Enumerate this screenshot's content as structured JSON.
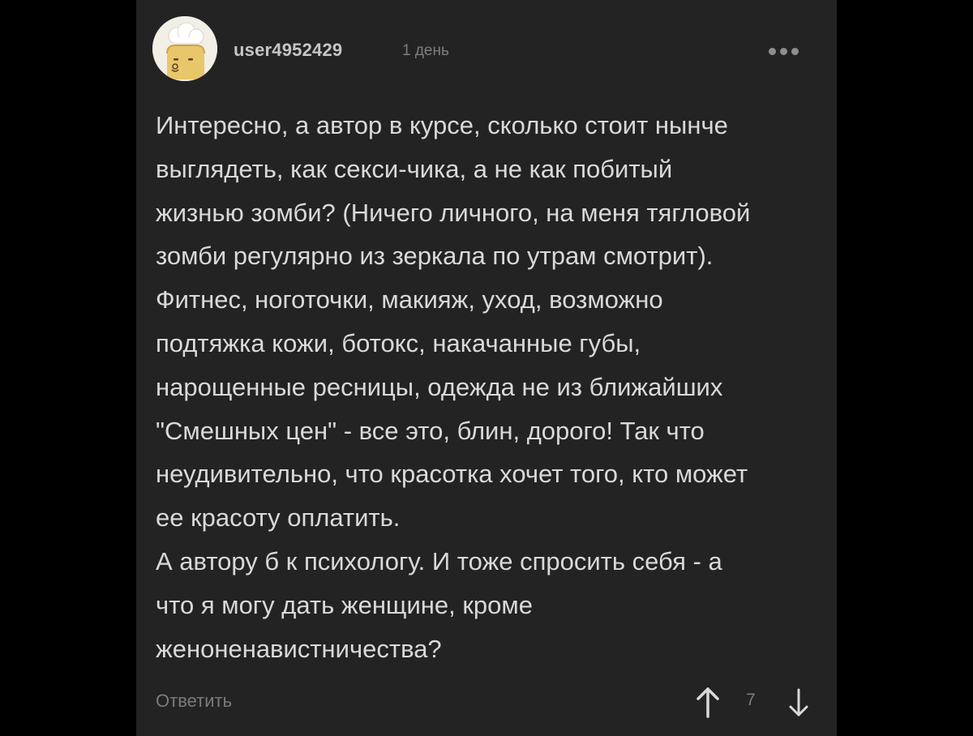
{
  "comment": {
    "author": {
      "username": "user4952429",
      "avatar_icon": "chef-hat-toast-avatar-icon"
    },
    "posted_ago": "1 день",
    "more_icon": "more-dots-icon",
    "text_lines": [
      "Интересно, а автор в курсе, сколько стоит нынче",
      "выглядеть, как секси-чика, а не как побитый",
      "жизнью зомби? (Ничего личного, на меня тягловой",
      "зомби регулярно из зеркала по утрам смотрит).",
      "Фитнес, ноготочки, макияж, уход, возможно",
      "подтяжка кожи, ботокс, накачанные губы,",
      "нарощенные ресницы, одежда не из ближайших",
      "\"Смешных цен\" - все это, блин, дорого! Так что",
      "неудивительно, что красотка хочет того, кто может",
      "ее красоту оплатить.",
      "А автору б к психологу. И тоже спросить себя - а",
      "что я могу дать женщине, кроме",
      "женоненавистничества?"
    ],
    "actions": {
      "reply_label": "Ответить",
      "upvote_icon": "arrow-up-icon",
      "downvote_icon": "arrow-down-icon",
      "rating": "7"
    }
  },
  "colors": {
    "page_background": "#000000",
    "card_background": "#232323",
    "text": "#d9d9d9",
    "muted": "#7b7b7b",
    "avatar_background": "#f1efe6",
    "avatar_face": "#e8c66a"
  }
}
